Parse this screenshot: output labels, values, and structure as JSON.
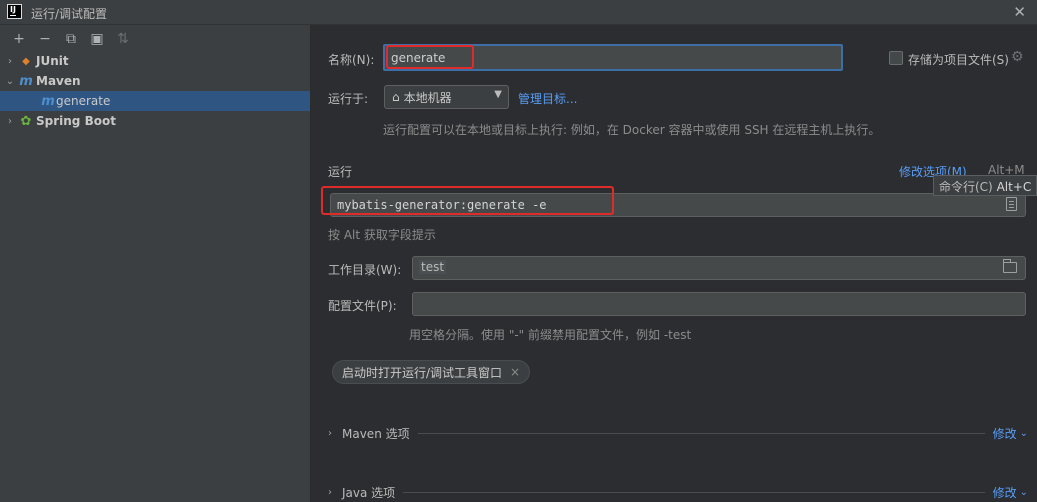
{
  "window": {
    "title": "运行/调试配置",
    "logo_text": "IJ",
    "close_glyph": "✕"
  },
  "toolbar": {
    "add": "+",
    "remove": "−",
    "copy": "⧉",
    "folder": "▣",
    "sort": "⇅"
  },
  "tree": [
    {
      "label": "JUnit",
      "icon": "junit-icon",
      "expanded": false
    },
    {
      "label": "Maven",
      "icon": "maven-icon",
      "expanded": true
    },
    {
      "label": "generate",
      "icon": "maven-icon",
      "selected": true
    },
    {
      "label": "Spring Boot",
      "icon": "spring-boot-icon",
      "expanded": false
    }
  ],
  "form": {
    "name_label": "名称(N):",
    "name_value": "generate",
    "store_label": "存储为项目文件(S)",
    "run_on_label": "运行于:",
    "run_on_value": "本地机器",
    "manage_targets": "管理目标...",
    "run_on_hint": "运行配置可以在本地或目标上执行: 例如，在 Docker 容器中或使用 SSH 在远程主机上执行。",
    "run_section": "运行",
    "modify_options": "修改选项(M)",
    "modify_shortcut": "Alt+M",
    "tooltip_label": "命令行(C)",
    "tooltip_shortcut": "Alt+C",
    "command_value": "mybatis-generator:generate -e",
    "alt_hint": "按 Alt 获取字段提示",
    "workdir_label": "工作目录(W):",
    "workdir_value": "test",
    "profiles_label": "配置文件(P):",
    "profiles_value": "",
    "profiles_hint": "用空格分隔。使用 \"-\" 前缀禁用配置文件，例如 -test",
    "chip_label": "启动时打开运行/调试工具窗口",
    "chip_close": "×"
  },
  "sections": [
    {
      "label": "Maven 选项",
      "modify": "修改"
    },
    {
      "label": "Java 选项",
      "modify": "修改"
    }
  ]
}
